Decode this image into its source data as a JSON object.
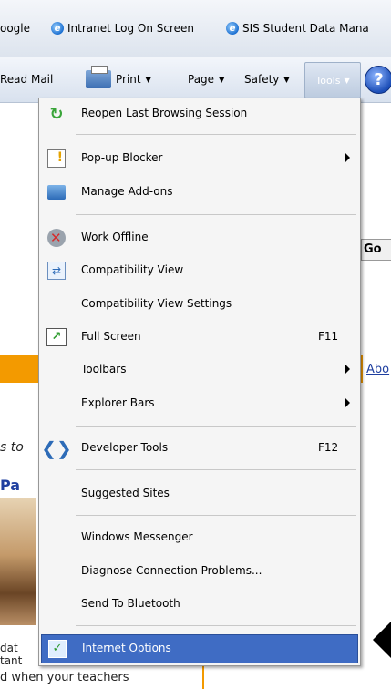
{
  "favorites": [
    {
      "label": "oogle"
    },
    {
      "label": "Intranet Log On Screen"
    },
    {
      "label": "SIS Student Data Mana"
    }
  ],
  "command_bar": {
    "read_mail": "Read Mail",
    "print": "Print",
    "page": "Page",
    "safety": "Safety",
    "tools": "Tools",
    "help": "?"
  },
  "background": {
    "go_button": "Go",
    "about_link": "Abo",
    "italic_text": "s to",
    "heading_fragment": "Pa",
    "body_lines": [
      "dat",
      "tant",
      "d when your teachers"
    ]
  },
  "menu": {
    "items": [
      {
        "label": "Reopen Last Browsing Session",
        "icon": "reopen-session-icon"
      },
      {
        "label": "Pop-up Blocker",
        "icon": "popup-blocker-icon",
        "submenu": true
      },
      {
        "label": "Manage Add-ons",
        "icon": "addons-icon"
      },
      {
        "label": "Work Offline",
        "icon": "work-offline-icon"
      },
      {
        "label": "Compatibility View",
        "icon": "compatibility-view-icon"
      },
      {
        "label": "Compatibility View Settings"
      },
      {
        "label": "Full Screen",
        "icon": "full-screen-icon",
        "shortcut": "F11"
      },
      {
        "label": "Toolbars",
        "submenu": true
      },
      {
        "label": "Explorer Bars",
        "submenu": true
      },
      {
        "label": "Developer Tools",
        "icon": "developer-tools-icon",
        "shortcut": "F12"
      },
      {
        "label": "Suggested Sites"
      },
      {
        "label": "Windows Messenger"
      },
      {
        "label": "Diagnose Connection Problems..."
      },
      {
        "label": "Send To Bluetooth"
      },
      {
        "label": "Internet Options",
        "icon": "internet-options-icon",
        "highlighted": true
      }
    ]
  }
}
